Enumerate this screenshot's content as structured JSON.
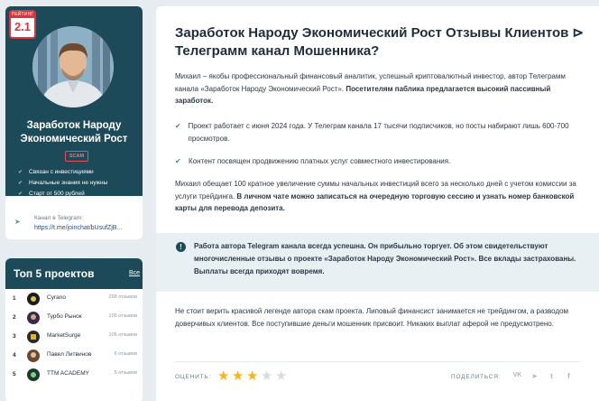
{
  "profile": {
    "rating_label": "РЕЙТИНГ",
    "rating_value": "2.1",
    "name_line1": "Заработок Народу",
    "name_line2": "Экономический Рост",
    "scam_badge": "SCAM",
    "features": [
      "Связан с инвестициями",
      "Начальные знания не нужны",
      "Старт от 500 рублей"
    ],
    "tg_label": "Канал в Telegram:",
    "tg_url": "https://t.me/joinchat/bUsufZjB..."
  },
  "top": {
    "title": "Топ 5 проектов",
    "all_link": "Все",
    "items": [
      {
        "num": "1",
        "name": "Cyrano",
        "count": "268 отзывов",
        "color": "#1b1b1b"
      },
      {
        "num": "2",
        "name": "Турбо Рынок",
        "count": "109 отзывов",
        "color": "#3a2a4a"
      },
      {
        "num": "3",
        "name": "MarketSurge",
        "count": "105 отзывов",
        "color": "#2a2a2a"
      },
      {
        "num": "4",
        "name": "Павел Литвинов",
        "count": "6 отзывов",
        "color": "#6a4a2e"
      },
      {
        "num": "5",
        "name": "TTM ACADEMY",
        "count": "5 отзывов",
        "color": "#1b3a2a"
      }
    ]
  },
  "article": {
    "title": "Заработок Народу Экономический Рост Отзывы Клиентов ⊳ Телеграмм канал Мошенника?",
    "intro_plain": "Михаил – якобы профессиональный финансовый аналитик, успешный криптовалютный инвестор, автор Телеграмм канала «Заработок Народу Экономический Рост».",
    "intro_bold": "Посетителям паблика предлагается высокий пассивный заработок.",
    "check1": "Проект работает с июня 2024 года. У Телеграм канала 17 тысячи подписчиков, но посты набирают лишь 600-700 просмотров.",
    "check2": "Контент посвящен продвижению платных услуг совместного инвестирования.",
    "para2_plain": "Михаил обещает 100 кратное увеличение суммы начальных инвестиций всего за несколько дней с учетом комиссии за услуги трейдинга.",
    "para2_bold": "В личном чате можно записаться на очередную торговую сессию и узнать номер банковской карты для перевода депозита.",
    "info": "Работа автора Telegram канала всегда успешна. Он прибыльно торгует. Об этом свидетельствуют многочисленные отзывы о проекте «Заработок Народу Экономический Рост». Все вклады застрахованы. Выплаты всегда приходят вовремя.",
    "para3": "Не стоит верить красивой легенде автора скам проекта. Липовый финансист занимается не трейдингом, а разводом доверчивых клиентов. Все поступившие деньги мошенник присвоит. Никаких выплат аферой не предусмотрено."
  },
  "footer": {
    "rate_label": "ОЦЕНИТЬ:",
    "rating_stars": 3,
    "max_stars": 5,
    "share_label": "ПОДЕЛИТЬСЯ:",
    "share_icons": [
      "vk-icon",
      "telegram-icon",
      "twitter-icon",
      "facebook-icon"
    ]
  },
  "colors": {
    "brand_dark": "#1d4a58",
    "scam_red": "#d7373f",
    "star_gold": "#f6b418",
    "check_green": "#3c8d6b"
  }
}
